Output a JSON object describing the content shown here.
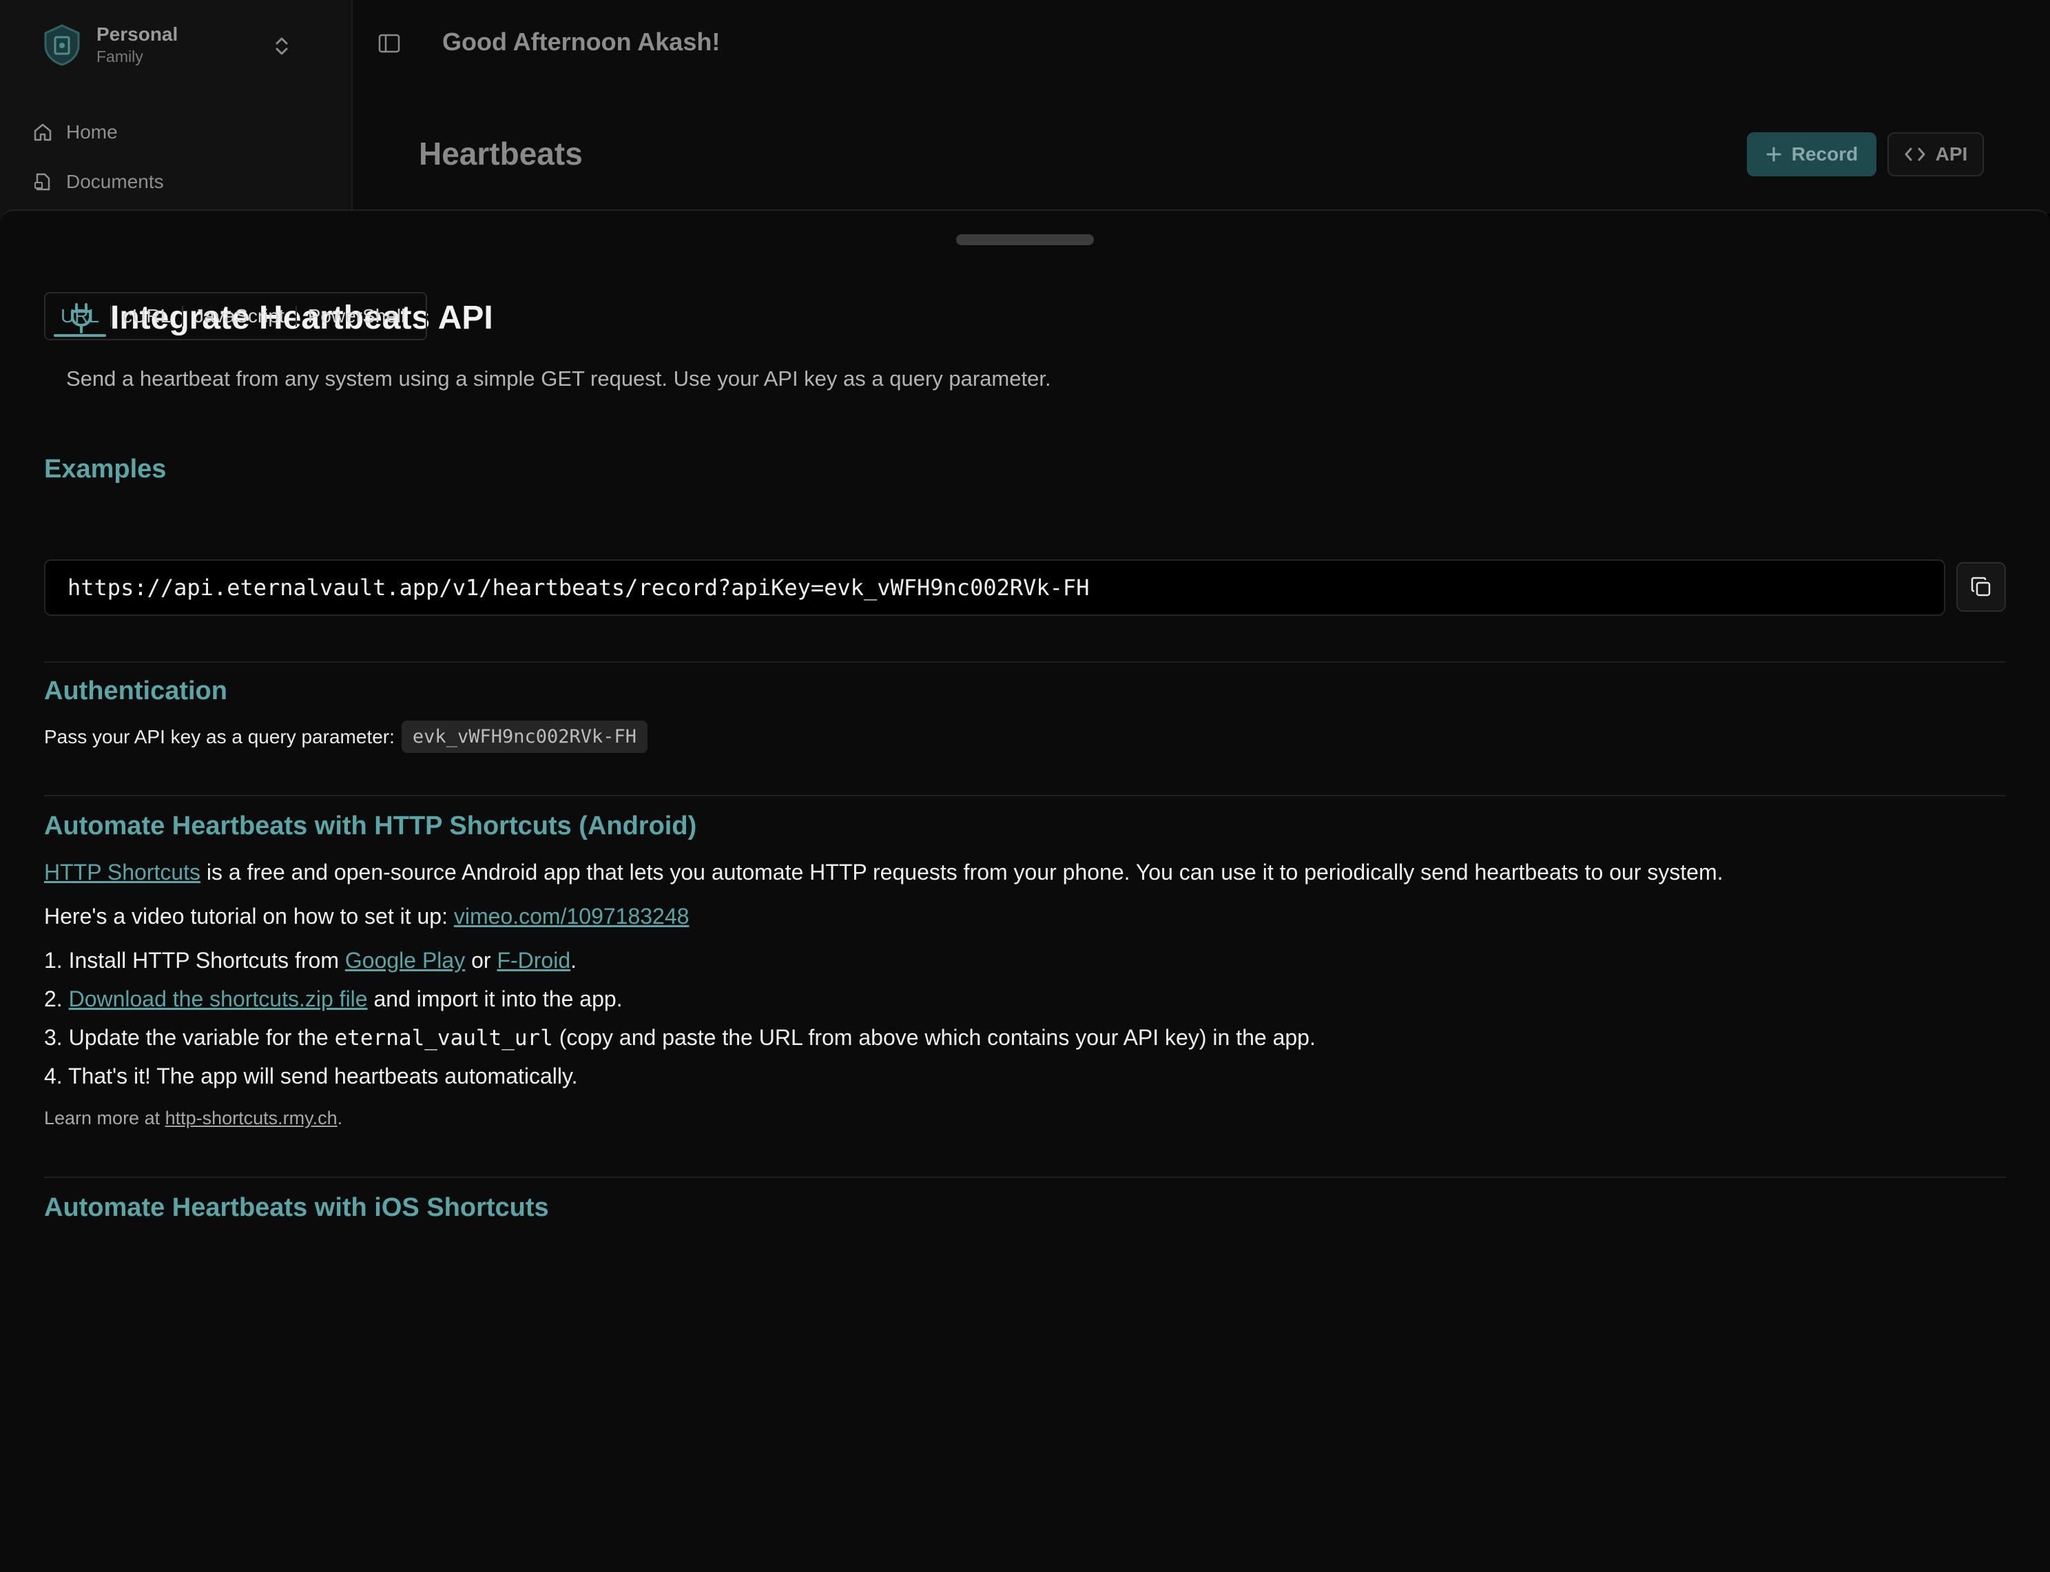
{
  "workspace": {
    "name": "Personal",
    "subtitle": "Family"
  },
  "sidebar": {
    "items": [
      {
        "label": "Home",
        "icon": "home-icon"
      },
      {
        "label": "Documents",
        "icon": "document-lock-icon"
      }
    ]
  },
  "header": {
    "greeting": "Good Afternoon Akash!"
  },
  "page": {
    "title": "Heartbeats",
    "record_label": "Record",
    "api_label": "API"
  },
  "sheet": {
    "title": "Integrate Heartbeats API",
    "description": "Send a heartbeat from any system using a simple GET request. Use your API key as a query parameter.",
    "examples": {
      "heading": "Examples",
      "tabs": [
        "URL",
        "cURL",
        "JavaScript",
        "PowerShell"
      ],
      "active_tab": "URL",
      "url": "https://api.eternalvault.app/v1/heartbeats/record?apiKey=evk_vWFH9nc002RVk-FH"
    },
    "authentication": {
      "heading": "Authentication",
      "text": "Pass your API key as a query parameter:",
      "api_key": "evk_vWFH9nc002RVk-FH"
    },
    "android": {
      "heading": "Automate Heartbeats with HTTP Shortcuts (Android)",
      "intro_link": "HTTP Shortcuts",
      "intro_text": " is a free and open-source Android app that lets you automate HTTP requests from your phone. You can use it to periodically send heartbeats to our system.",
      "video_text": "Here's a video tutorial on how to set it up: ",
      "video_link": "vimeo.com/1097183248",
      "step1_prefix": "1. Install HTTP Shortcuts from ",
      "step1_link1": "Google Play",
      "step1_mid": " or ",
      "step1_link2": "F-Droid",
      "step1_suffix": ".",
      "step2_prefix": "2. ",
      "step2_link": "Download the shortcuts.zip file",
      "step2_suffix": " and import it into the app.",
      "step3_prefix": "3. Update the variable for the ",
      "step3_code": "eternal_vault_url",
      "step3_suffix": " (copy and paste the URL from above which contains your API key) in the app.",
      "step4": "4. That's it! The app will send heartbeats automatically.",
      "learn_prefix": "Learn more at ",
      "learn_link": "http-shortcuts.rmy.ch",
      "learn_suffix": "."
    },
    "ios": {
      "heading": "Automate Heartbeats with iOS Shortcuts"
    }
  },
  "colors": {
    "accent": "#5aa6a6",
    "record_bg": "#1e4a4d"
  }
}
